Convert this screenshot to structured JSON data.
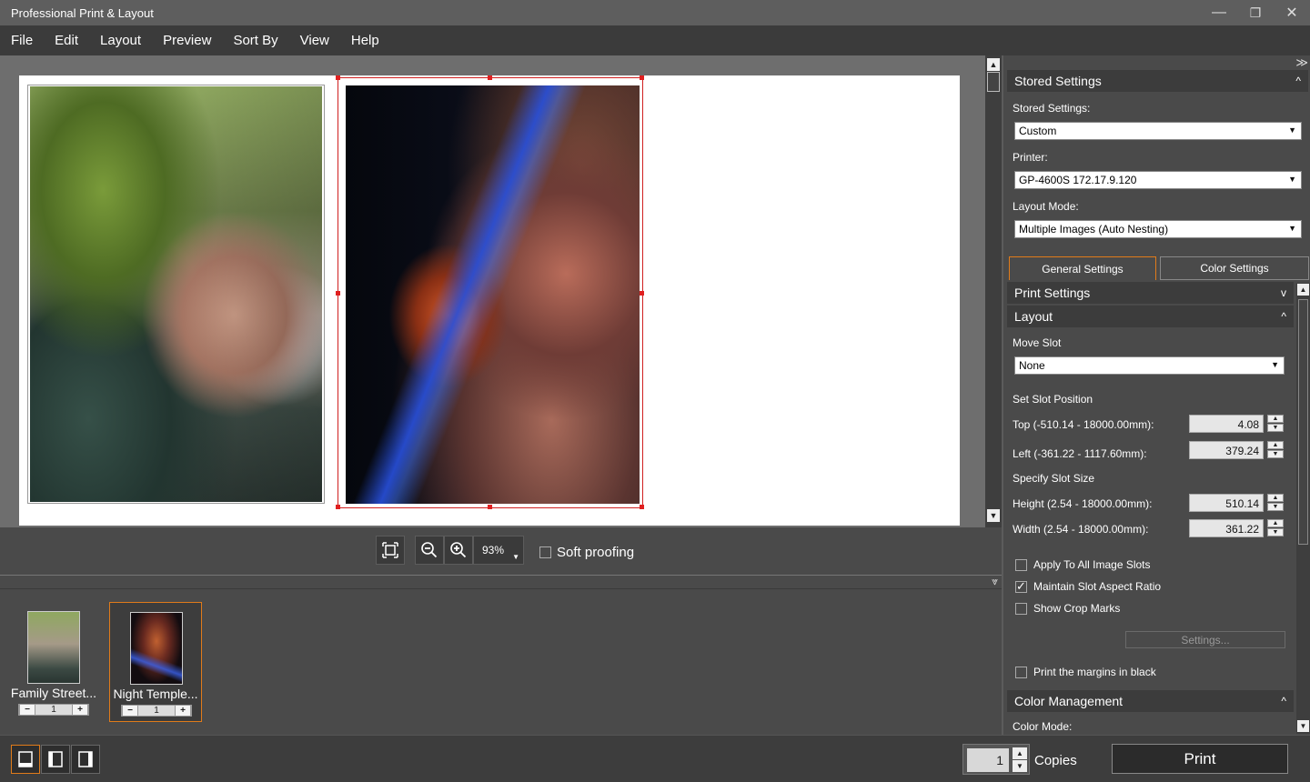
{
  "window": {
    "title": "Professional Print & Layout",
    "minimize": "—",
    "restore": "❐",
    "close": "✕"
  },
  "menu": [
    "File",
    "Edit",
    "Layout",
    "Preview",
    "Sort By",
    "View",
    "Help"
  ],
  "toolbar": {
    "zoom": "93%",
    "soft_proofing": "Soft proofing",
    "soft_proofing_checked": false
  },
  "thumbnails": [
    {
      "name": "Family Street...",
      "count": "1",
      "selected": false
    },
    {
      "name": "Night Temple...",
      "count": "1",
      "selected": true
    }
  ],
  "bottom": {
    "copies_value": "1",
    "copies_label": "Copies",
    "print_label": "Print"
  },
  "panel": {
    "stored_settings_header": "Stored Settings",
    "stored_settings_label": "Stored Settings:",
    "stored_settings_value": "Custom",
    "printer_label": "Printer:",
    "printer_value": "GP-4600S 172.17.9.120",
    "layout_mode_label": "Layout Mode:",
    "layout_mode_value": "Multiple Images (Auto Nesting)",
    "tabs": [
      "General Settings",
      "Color Settings"
    ],
    "print_settings_header": "Print Settings",
    "layout_header": "Layout",
    "move_slot_label": "Move Slot",
    "move_slot_value": "None",
    "set_slot_position": "Set Slot Position",
    "top_label": "Top (-510.14 - 18000.00mm):",
    "top_value": "4.08",
    "left_label": "Left (-361.22 - 1117.60mm):",
    "left_value": "379.24",
    "specify_slot_size": "Specify Slot Size",
    "height_label": "Height (2.54 - 18000.00mm):",
    "height_value": "510.14",
    "width_label": "Width (2.54 - 18000.00mm):",
    "width_value": "361.22",
    "apply_all": "Apply To All Image Slots",
    "apply_all_checked": false,
    "maintain_ratio": "Maintain Slot Aspect Ratio",
    "maintain_ratio_checked": true,
    "show_crop": "Show Crop Marks",
    "show_crop_checked": false,
    "settings_button": "Settings...",
    "margins_black": "Print the margins in black",
    "margins_black_checked": false,
    "color_mgmt_header": "Color Management",
    "color_mode_label": "Color Mode:"
  },
  "colors": {
    "accent": "#e07b1a",
    "selection": "#d02020"
  }
}
